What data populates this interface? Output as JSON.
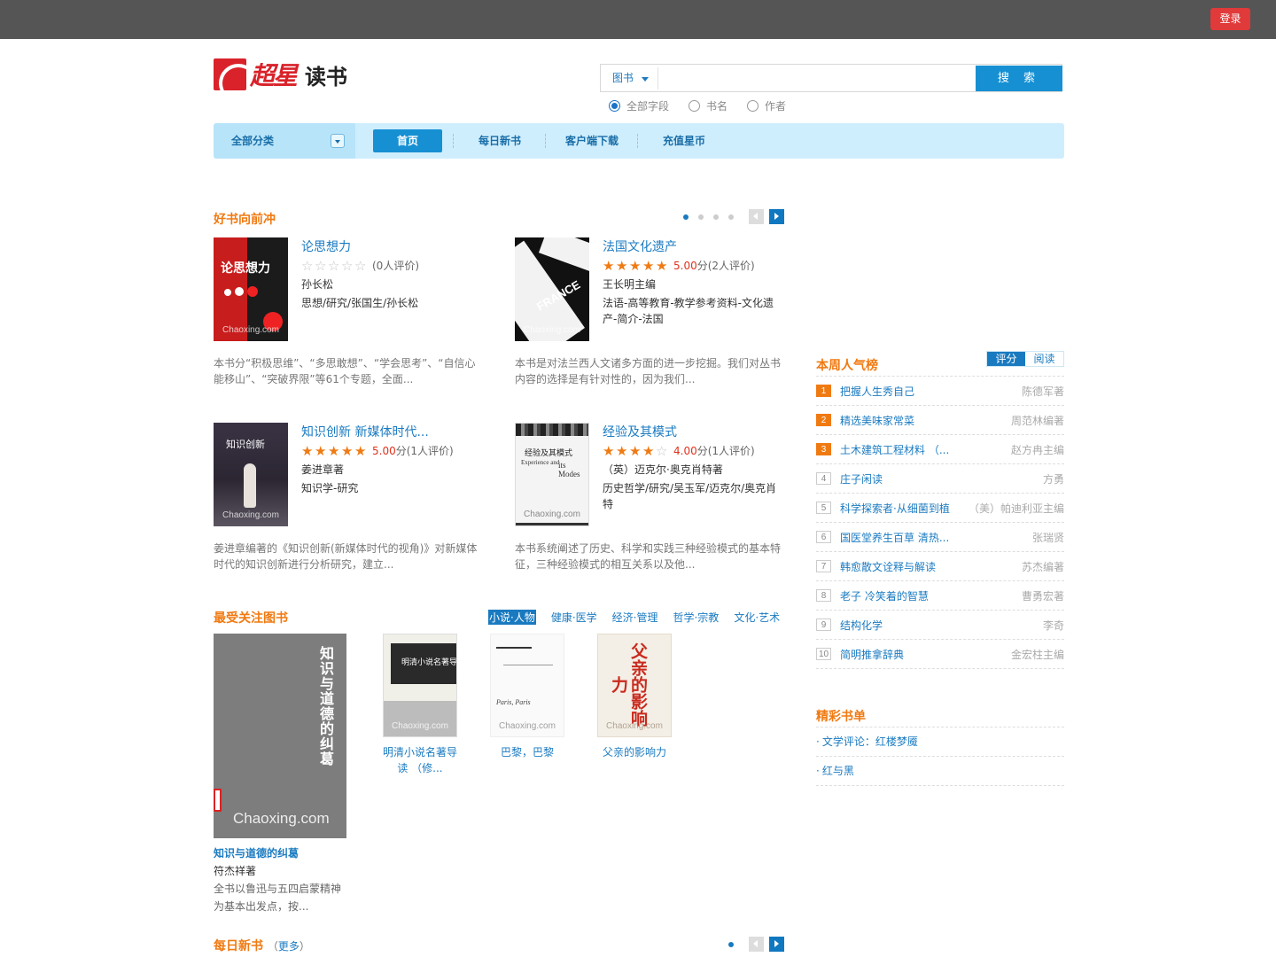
{
  "topbar": {
    "login_label": "登录"
  },
  "logo": {
    "brand": "超星",
    "product": "读书"
  },
  "search": {
    "type_label": "图书",
    "placeholder": "",
    "button_label": "搜 索",
    "radios": [
      {
        "label": "全部字段",
        "checked": true
      },
      {
        "label": "书名",
        "checked": false
      },
      {
        "label": "作者",
        "checked": false
      }
    ]
  },
  "nav": {
    "category_label": "全部分类",
    "items": [
      "首页",
      "每日新书",
      "客户端下载",
      "充值星币"
    ]
  },
  "hot": {
    "title": "好书向前冲",
    "pages": 4,
    "current_page": 1,
    "books": [
      {
        "title": "论思想力",
        "rating": 0,
        "score": "",
        "rating_text": "(0人评价)",
        "author": "孙长松",
        "subject": "思想/研究/张国生/孙长松",
        "desc": "本书分“积极思维”、“多思敢想”、“学会思考”、“自信心能移山”、“突破界限”等61个专题，全面...",
        "cover_text": "论思想力"
      },
      {
        "title": "法国文化遗产",
        "rating": 5,
        "score": "5.00",
        "rating_text": "分(2人评价)",
        "author": "王长明主编",
        "subject": "法语-高等教育-教学参考资料-文化遗产-简介-法国",
        "desc": "本书是对法兰西人文诸多方面的进一步挖掘。我们对丛书内容的选择是有针对性的，因为我们...",
        "cover_text": "FRANCE"
      },
      {
        "title": "知识创新 新媒体时代...",
        "rating": 5,
        "score": "5.00",
        "rating_text": "分(1人评价)",
        "author": "姜进章著",
        "subject": "知识学-研究",
        "desc": "姜进章编著的《知识创新(新媒体时代的视角)》对新媒体时代的知识创新进行分析研究，建立...",
        "cover_text": "知识创新"
      },
      {
        "title": "经验及其模式",
        "rating": 4,
        "score": "4.00",
        "rating_text": "分(1人评价)",
        "author": "（英）迈克尔·奥克肖特著",
        "subject": "历史哲学/研究/吴玉军/迈克尔/奥克肖特",
        "desc": "本书系统阐述了历史、科学和实践三种经验模式的基本特征，三种经验模式的相互关系以及他...",
        "cover_text": "经验及其模式"
      }
    ],
    "watermark": "Chaoxing.com"
  },
  "popular": {
    "title": "最受关注图书",
    "tabs": [
      "小说·人物",
      "健康·医学",
      "经济·管理",
      "哲学·宗教",
      "文化·艺术"
    ],
    "active_tab": 0,
    "featured": {
      "title": "知识与道德的纠葛",
      "author": "符杰祥著",
      "desc": "全书以鲁迅与五四启蒙精神为基本出发点，按...",
      "cover_text": "知识与道德的纠葛"
    },
    "books": [
      {
        "title": "明清小说名著导读 （修...",
        "cover_text": "明清小说名著导读"
      },
      {
        "title": "巴黎，巴黎",
        "cover_text": "Paris, Paris"
      },
      {
        "title": "父亲的影响力",
        "cover_text": "父亲的影响力"
      }
    ]
  },
  "daily": {
    "title": "每日新书",
    "more_label": "更多",
    "pages": 1
  },
  "ranking": {
    "title": "本周人气榜",
    "tabs": [
      "评分",
      "阅读"
    ],
    "active_tab": 0,
    "items": [
      {
        "num": "1",
        "title": "把握人生秀自己",
        "author": "陈德军著"
      },
      {
        "num": "2",
        "title": "精选美味家常菜",
        "author": "周范林编著"
      },
      {
        "num": "3",
        "title": "土木建筑工程材料 （...",
        "author": "赵方冉主编"
      },
      {
        "num": "4",
        "title": "庄子闲读",
        "author": "方勇"
      },
      {
        "num": "5",
        "title": "科学探索者·从细菌到植",
        "author": "（美）帕迪利亚主编"
      },
      {
        "num": "6",
        "title": "国医堂养生百草 清热...",
        "author": "张瑞贤"
      },
      {
        "num": "7",
        "title": "韩愈散文诠释与解读",
        "author": "苏杰编著"
      },
      {
        "num": "8",
        "title": "老子 冷笑着的智慧",
        "author": "曹勇宏著"
      },
      {
        "num": "9",
        "title": "结构化学",
        "author": "李奇"
      },
      {
        "num": "10",
        "title": "简明推拿辞典",
        "author": "金宏柱主编"
      }
    ]
  },
  "booklists": {
    "title": "精彩书单",
    "items": [
      "文学评论：红楼梦魇",
      "红与黑"
    ]
  },
  "colors": {
    "accent": "#1690d3",
    "heading": "#f07a12",
    "link": "#1b7bc1",
    "login": "#e03a3a"
  }
}
